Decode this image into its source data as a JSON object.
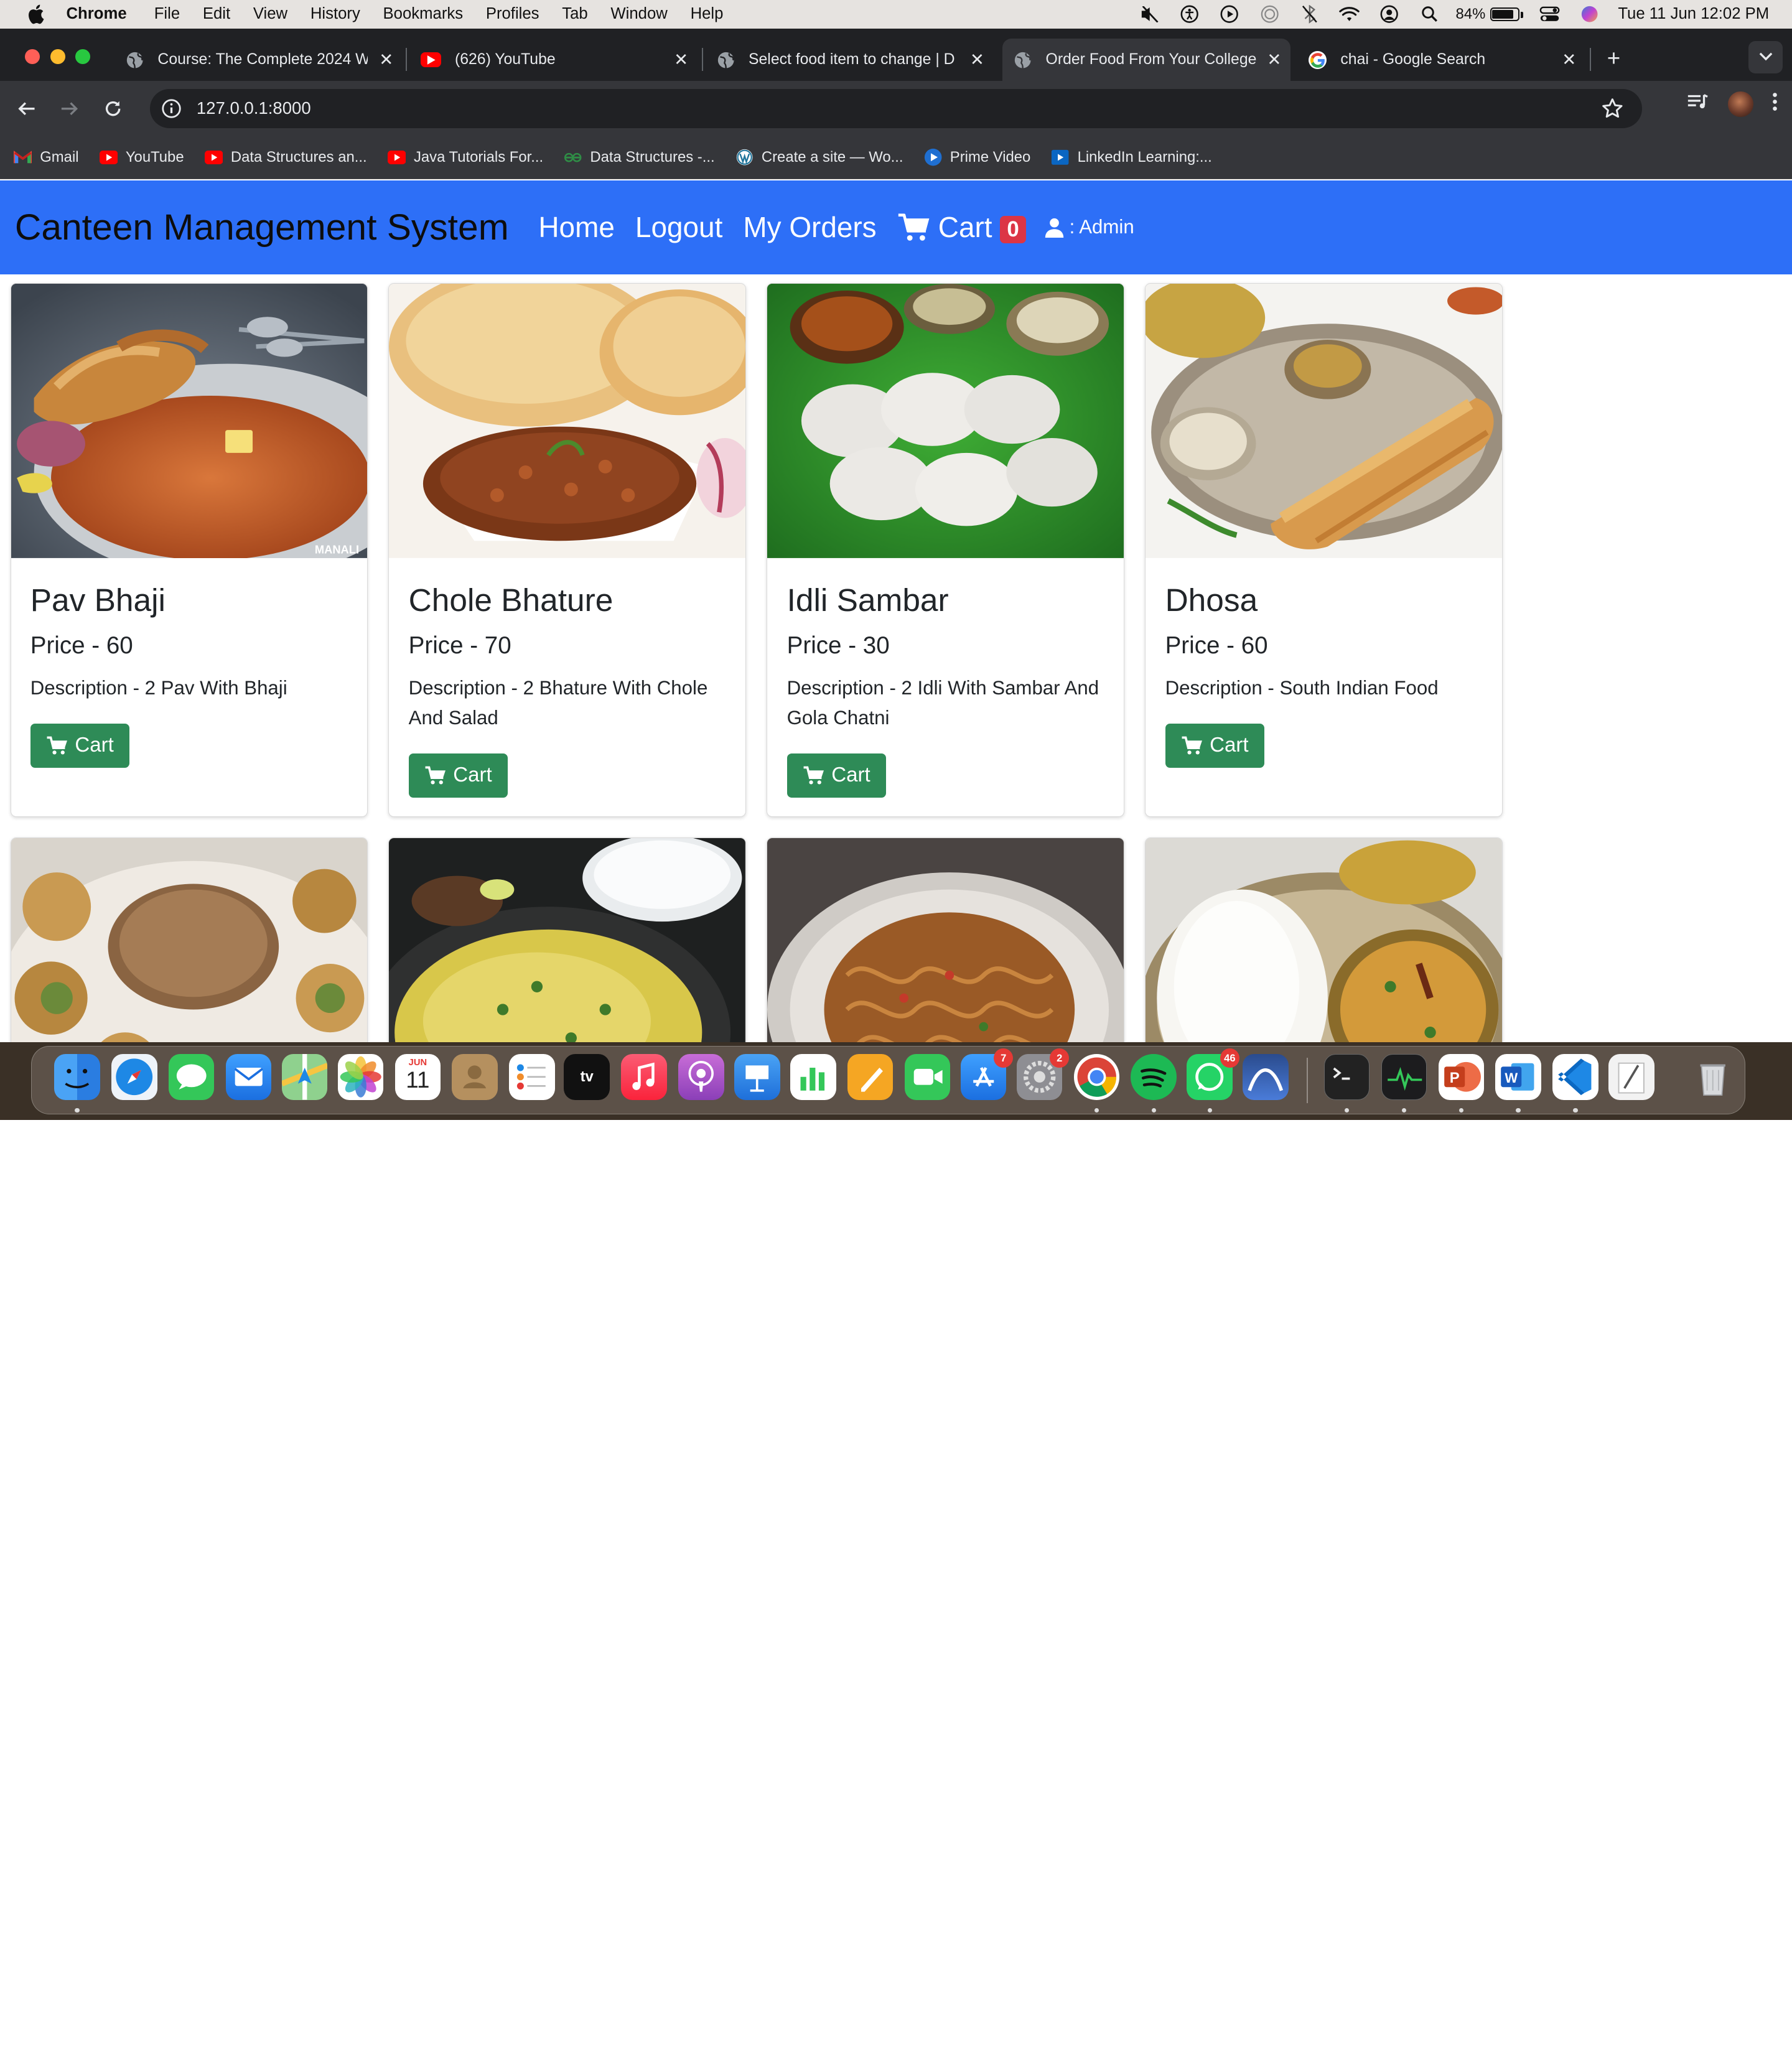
{
  "menubar": {
    "app": "Chrome",
    "items": [
      "File",
      "Edit",
      "View",
      "History",
      "Bookmarks",
      "Profiles",
      "Tab",
      "Window",
      "Help"
    ],
    "battery_percent": "84%",
    "battery_level": 0.84,
    "clock": "Tue 11 Jun  12:02 PM"
  },
  "browser": {
    "tabs": [
      {
        "title": "Course: The Complete 2024 W",
        "icon": "globe-icon"
      },
      {
        "title": "(626) YouTube",
        "icon": "youtube-icon"
      },
      {
        "title": "Select food item to change | D",
        "icon": "globe-icon"
      },
      {
        "title": "Order Food From Your College",
        "icon": "globe-icon",
        "active": true
      },
      {
        "title": "chai - Google Search",
        "icon": "google-icon"
      }
    ],
    "url": "127.0.0.1:8000",
    "bookmarks": [
      {
        "label": "Gmail",
        "icon": "gmail-icon"
      },
      {
        "label": "YouTube",
        "icon": "youtube-icon"
      },
      {
        "label": "Data Structures an...",
        "icon": "youtube-icon"
      },
      {
        "label": "Java Tutorials For...",
        "icon": "youtube-icon"
      },
      {
        "label": "Data Structures -...",
        "icon": "gfg-icon"
      },
      {
        "label": "Create a site — Wo...",
        "icon": "wordpress-icon"
      },
      {
        "label": "Prime Video",
        "icon": "prime-icon"
      },
      {
        "label": "LinkedIn Learning:...",
        "icon": "linkedin-learning-icon"
      }
    ]
  },
  "site": {
    "brand": "Canteen Management System",
    "nav": {
      "home": "Home",
      "logout": "Logout",
      "orders": "My Orders",
      "cart": "Cart",
      "cart_count": "0",
      "user": ": Admin"
    },
    "colors": {
      "navbar": "#2d6ff7",
      "cart_button": "#2e8b57",
      "badge": "#dc3545"
    }
  },
  "foods": [
    {
      "name": "Pav Bhaji",
      "price": "Price - 60",
      "description": "Description - 2 Pav With Bhaji",
      "button": "Cart",
      "image_watermark": "MANALI"
    },
    {
      "name": "Chole Bhature",
      "price": "Price - 70",
      "description": "Description - 2 Bhature With Chole And Salad",
      "button": "Cart"
    },
    {
      "name": "Idli Sambar",
      "price": "Price - 30",
      "description": "Description - 2 Idli With Sambar And Gola Chatni",
      "button": "Cart"
    },
    {
      "name": "Dhosa",
      "price": "Price - 60",
      "description": "Description - South Indian Food",
      "button": "Cart"
    }
  ],
  "dock": {
    "apps": [
      "Finder",
      "Safari",
      "Messages",
      "Mail",
      "Maps",
      "Photos",
      "Calendar",
      "Contacts",
      "Reminders",
      "Apple TV",
      "Music",
      "Podcasts",
      "Keynote",
      "Numbers",
      "Pages",
      "FaceTime",
      "App Store",
      "System Settings",
      "Chrome",
      "Spotify",
      "WhatsApp",
      "Sublime",
      "Terminal",
      "Activity Monitor",
      "PowerPoint",
      "Word",
      "VS Code",
      "Preview",
      "Trash"
    ],
    "calendar_month": "JUN",
    "calendar_day": "11",
    "badges": {
      "app_store": "7",
      "settings": "2",
      "whatsapp": "46"
    }
  }
}
